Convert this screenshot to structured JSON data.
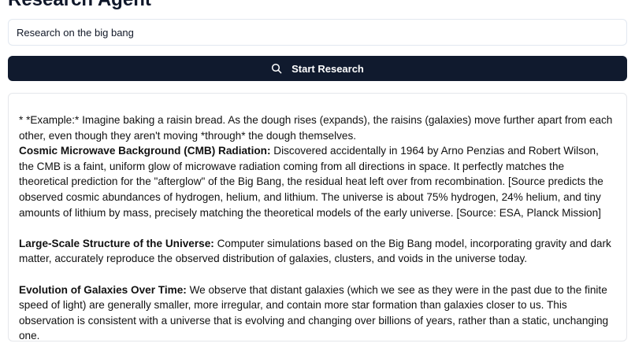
{
  "header": {
    "title": "Research Agent"
  },
  "search": {
    "value": "Research on the big bang"
  },
  "start_button": {
    "label": "Start Research",
    "icon": "search-icon"
  },
  "result": {
    "example_line": "* *Example:* Imagine baking a raisin bread. As the dough rises (expands), the raisins (galaxies) move further apart from each other, even though they aren't moving *through* the dough themselves.",
    "sections": [
      {
        "heading": "Cosmic Microwave Background (CMB) Radiation:",
        "body": "Discovered accidentally in 1964 by Arno Penzias and Robert Wilson, the CMB is a faint, uniform glow of microwave radiation coming from all directions in space. It perfectly matches the theoretical prediction for the \"afterglow\" of the Big Bang, the residual heat left over from recombination. [Source predicts the observed cosmic abundances of hydrogen, helium, and lithium. The universe is about 75% hydrogen, 24% helium, and tiny amounts of lithium by mass, precisely matching the theoretical models of the early universe. [Source: ESA, Planck Mission]"
      },
      {
        "heading": "Large-Scale Structure of the Universe:",
        "body": "Computer simulations based on the Big Bang model, incorporating gravity and dark matter, accurately reproduce the observed distribution of galaxies, clusters, and voids in the universe today."
      },
      {
        "heading": "Evolution of Galaxies Over Time:",
        "body": "We observe that distant galaxies (which we see as they were in the past due to the finite speed of light) are generally smaller, more irregular, and contain more star formation than galaxies closer to us. This observation is consistent with a universe that is evolving and changing over billions of years, rather than a static, unchanging one."
      }
    ]
  },
  "colors": {
    "button_bg": "#101a2e",
    "border": "#e2e8f0",
    "text": "#111111"
  }
}
